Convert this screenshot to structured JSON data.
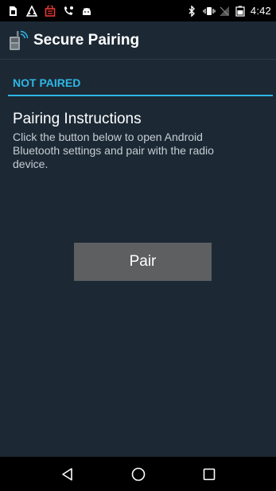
{
  "status_bar": {
    "clock": "4:42",
    "left_icons": [
      "sim-icon",
      "warning-icon",
      "shopping-bag-icon",
      "voicemail-icon",
      "android-icon"
    ],
    "right_icons": [
      "bluetooth-icon",
      "vibrate-icon",
      "no-signal-icon",
      "battery-icon"
    ]
  },
  "app_bar": {
    "title": "Secure Pairing",
    "icon": "radio-device-icon"
  },
  "status_section": {
    "label": "NOT PAIRED",
    "accent_color": "#2fb7e6"
  },
  "instructions": {
    "title": "Pairing Instructions",
    "body": "Click the button below to open Android Bluetooth settings and pair with the radio device."
  },
  "pair_button": {
    "label": "Pair"
  },
  "nav_bar": {
    "buttons": [
      "back-icon",
      "home-icon",
      "recents-icon"
    ]
  },
  "colors": {
    "background": "#1c2935",
    "button": "#5d5f61",
    "status_bar": "#000000"
  }
}
